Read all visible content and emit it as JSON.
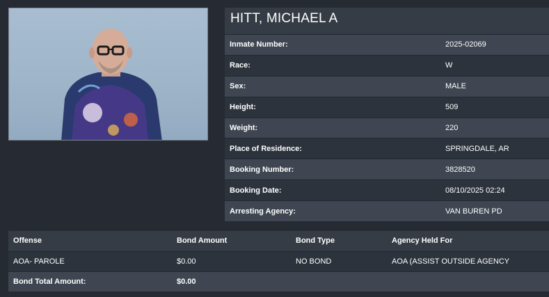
{
  "inmate": {
    "name": "HITT, MICHAEL A",
    "fields": [
      {
        "label": "Inmate Number:",
        "value": "2025-02069"
      },
      {
        "label": "Race:",
        "value": "W"
      },
      {
        "label": "Sex:",
        "value": "MALE"
      },
      {
        "label": "Height:",
        "value": "509"
      },
      {
        "label": "Weight:",
        "value": "220"
      },
      {
        "label": "Place of Residence:",
        "value": "SPRINGDALE, AR"
      },
      {
        "label": "Booking Number:",
        "value": "3828520"
      },
      {
        "label": "Booking Date:",
        "value": "08/10/2025 02:24"
      },
      {
        "label": "Arresting Agency:",
        "value": "VAN BUREN PD"
      }
    ]
  },
  "charges": {
    "headers": {
      "offense": "Offense",
      "bond_amount": "Bond Amount",
      "bond_type": "Bond Type",
      "agency_held_for": "Agency Held For"
    },
    "rows": [
      {
        "offense": "AOA- PAROLE",
        "bond_amount": "$0.00",
        "bond_type": "NO BOND",
        "agency_held_for": "AOA (ASSIST OUTSIDE AGENCY"
      }
    ],
    "total_label": "Bond Total Amount:",
    "total_value": "$0.00"
  },
  "colors": {
    "background": "#252a33",
    "header_bg": "#363c46",
    "row_light": "#3f4651",
    "row_dark": "#2d333c"
  }
}
